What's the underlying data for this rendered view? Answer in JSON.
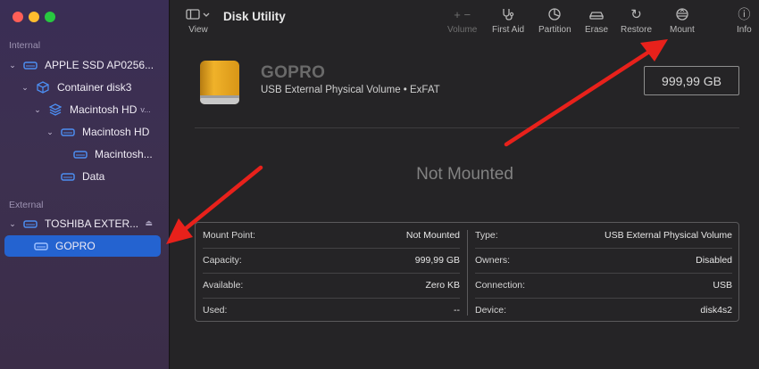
{
  "sidebar": {
    "internal_label": "Internal",
    "external_label": "External",
    "items": [
      {
        "label": "APPLE SSD AP0256...",
        "chevron": "⌄",
        "icon": "internal-drive-icon"
      },
      {
        "label": "Container disk3",
        "chevron": "⌄",
        "icon": "container-icon"
      },
      {
        "label": "Macintosh HD",
        "extra": "v...",
        "chevron": "⌄",
        "icon": "volume-group-icon"
      },
      {
        "label": "Macintosh HD",
        "chevron": "⌄",
        "icon": "volume-icon"
      },
      {
        "label": "Macintosh...",
        "icon": "volume-icon"
      },
      {
        "label": "Data",
        "icon": "volume-icon"
      },
      {
        "label": "TOSHIBA EXTER...",
        "chevron": "⌄",
        "icon": "external-drive-icon",
        "eject": "⏏"
      },
      {
        "label": "GOPRO",
        "icon": "volume-icon",
        "selected": true
      }
    ]
  },
  "toolbar": {
    "view_label": "View",
    "title": "Disk Utility",
    "buttons": [
      {
        "label": "Volume",
        "glyph": "+ | −",
        "enabled": false
      },
      {
        "label": "First Aid",
        "glyph": "stethoscope",
        "enabled": true
      },
      {
        "label": "Partition",
        "glyph": "pie",
        "enabled": true
      },
      {
        "label": "Erase",
        "glyph": "car",
        "enabled": true
      },
      {
        "label": "Restore",
        "glyph": "↻",
        "enabled": true
      },
      {
        "label": "Mount",
        "glyph": "mount",
        "enabled": true
      },
      {
        "label": "Info",
        "glyph": "ⓘ",
        "enabled": true
      }
    ]
  },
  "volume": {
    "name": "GOPRO",
    "subtitle": "USB External Physical Volume • ExFAT",
    "size": "999,99 GB",
    "status": "Not Mounted"
  },
  "info": {
    "left": [
      {
        "key": "Mount Point:",
        "value": "Not Mounted"
      },
      {
        "key": "Capacity:",
        "value": "999,99 GB"
      },
      {
        "key": "Available:",
        "value": "Zero KB"
      },
      {
        "key": "Used:",
        "value": "--"
      }
    ],
    "right": [
      {
        "key": "Type:",
        "value": "USB External Physical Volume"
      },
      {
        "key": "Owners:",
        "value": "Disabled"
      },
      {
        "key": "Connection:",
        "value": "USB"
      },
      {
        "key": "Device:",
        "value": "disk4s2"
      }
    ]
  },
  "colors": {
    "accent": "#2463d0",
    "annotation": "#e8211b",
    "drive": "#e6a21b"
  }
}
